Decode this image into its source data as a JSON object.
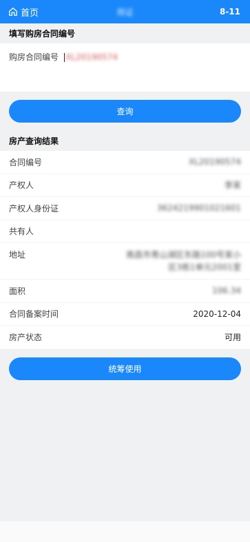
{
  "topbar": {
    "home_label": "首页",
    "title": "用证",
    "code": "8-11"
  },
  "contract_section": {
    "title": "填写购房合同编号",
    "input_label": "购房合同编号",
    "input_value": "XL20190574"
  },
  "query_button": "查询",
  "result_section": {
    "title": "房产查询结果",
    "rows": [
      {
        "label": "合同编号",
        "value": "XL20190574"
      },
      {
        "label": "产权人",
        "value": "李某"
      },
      {
        "label": "产权人身份证",
        "value": "3624219901021601"
      },
      {
        "label": "共有人",
        "value": ""
      },
      {
        "label": "地址",
        "value": "南昌市青山湖区东路100号某小区3栋1单元2001室"
      },
      {
        "label": "面积",
        "value": "106.34"
      },
      {
        "label": "合同备案时间",
        "value": "2020-12-04"
      },
      {
        "label": "房产状态",
        "value": "可用"
      }
    ]
  },
  "use_button": "统筹使用"
}
